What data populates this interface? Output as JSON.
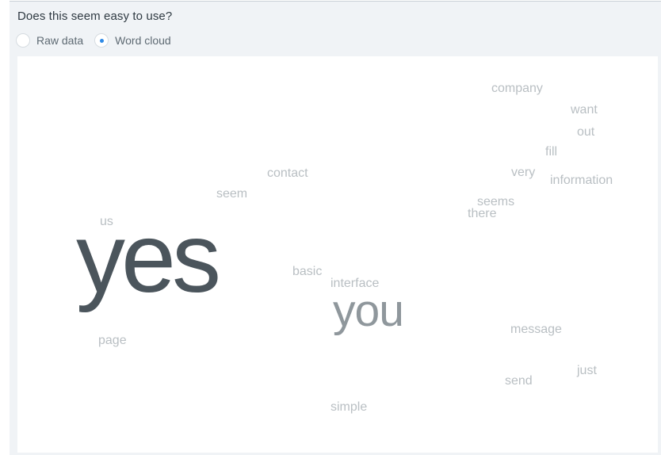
{
  "question": "Does this seem easy to use?",
  "view_options": [
    {
      "label": "Raw data",
      "selected": false
    },
    {
      "label": "Word cloud",
      "selected": true
    }
  ],
  "words": {
    "company": "company",
    "want": "want",
    "out": "out",
    "fill": "fill",
    "very": "very",
    "information": "information",
    "contact": "contact",
    "seem": "seem",
    "seems": "seems",
    "there": "there",
    "us": "us",
    "yes": "yes",
    "basic": "basic",
    "interface": "interface",
    "you": "you",
    "message": "message",
    "page": "page",
    "just": "just",
    "send": "send",
    "simple": "simple"
  },
  "colors": {
    "primary_word": "#4b555c",
    "secondary_word": "#8f979c",
    "minor_word": "#b9bfc3",
    "accent": "#2e8ae6"
  }
}
